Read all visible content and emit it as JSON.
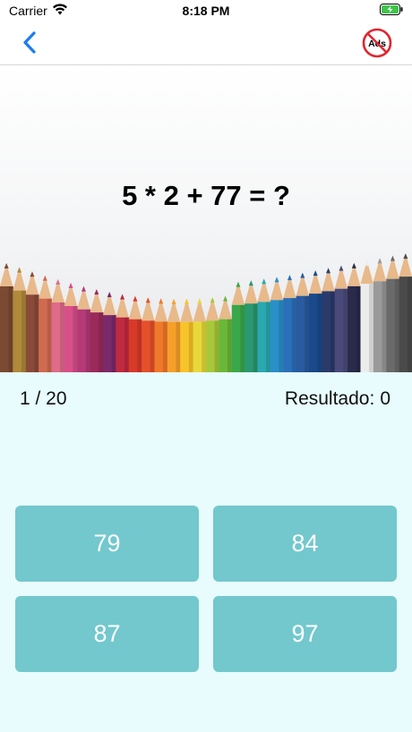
{
  "status_bar": {
    "carrier": "Carrier",
    "time": "8:18 PM",
    "icons": [
      "wifi-icon",
      "battery-charging-icon"
    ]
  },
  "nav": {
    "back_icon": "chevron-left-icon",
    "no_ads_label": "Ads",
    "accent_color": "#1a7cf0",
    "no_ads_color": "#e0262f"
  },
  "quiz": {
    "question": "5 * 2 + 77 = ?",
    "progress": "1 / 20",
    "score_label": "Resultado:",
    "score_value": "0",
    "answers": [
      "79",
      "84",
      "87",
      "97"
    ],
    "answer_color": "#72c8cd",
    "background_color": "#e8fcfd"
  }
}
